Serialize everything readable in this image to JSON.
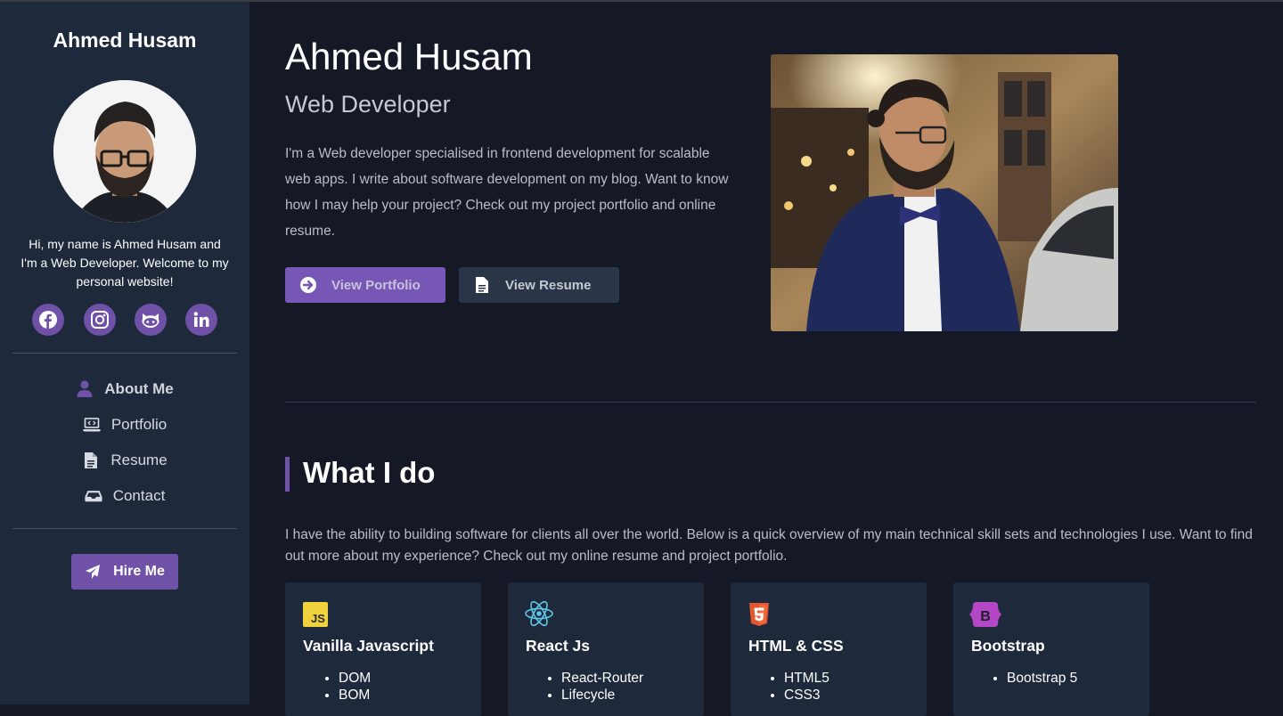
{
  "sidebar": {
    "name": "Ahmed Husam",
    "intro": "Hi, my name is Ahmed Husam and I'm a Web Developer. Welcome to my personal website!",
    "socials": [
      {
        "icon": "facebook-icon"
      },
      {
        "icon": "instagram-icon"
      },
      {
        "icon": "github-icon"
      },
      {
        "icon": "linkedin-icon"
      }
    ],
    "nav": [
      {
        "label": "About Me",
        "icon": "user-icon",
        "active": true
      },
      {
        "label": "Portfolio",
        "icon": "laptop-code-icon",
        "active": false
      },
      {
        "label": "Resume",
        "icon": "file-icon",
        "active": false
      },
      {
        "label": "Contact",
        "icon": "inbox-icon",
        "active": false
      }
    ],
    "hire_label": "Hire Me"
  },
  "main": {
    "name": "Ahmed Husam",
    "role": "Web Developer",
    "intro": "I'm a Web developer specialised in frontend development for scalable web apps. I write about software development on my blog. Want to know how I may help your project? Check out my project portfolio and online resume.",
    "portfolio_button": "View Portfolio",
    "resume_button": "View Resume"
  },
  "what_i_do": {
    "title": "What I do",
    "text": "I have the ability to building software for clients all over the world. Below is a quick overview of my main technical skill sets and technologies I use. Want to find out more about my experience? Check out my online resume and project portfolio.",
    "cards": [
      {
        "title": "Vanilla Javascript",
        "icon": "javascript-icon",
        "items": [
          "DOM",
          "BOM"
        ]
      },
      {
        "title": "React Js",
        "icon": "react-icon",
        "items": [
          "React-Router",
          "Lifecycle"
        ]
      },
      {
        "title": "HTML & CSS",
        "icon": "html5-icon",
        "items": [
          "HTML5",
          "CSS3"
        ]
      },
      {
        "title": "Bootstrap",
        "icon": "bootstrap-icon",
        "items": [
          "Bootstrap 5"
        ]
      }
    ]
  },
  "colors": {
    "accent": "#6f51a8",
    "sidebar_bg": "#1e293b",
    "page_bg": "#141925"
  }
}
